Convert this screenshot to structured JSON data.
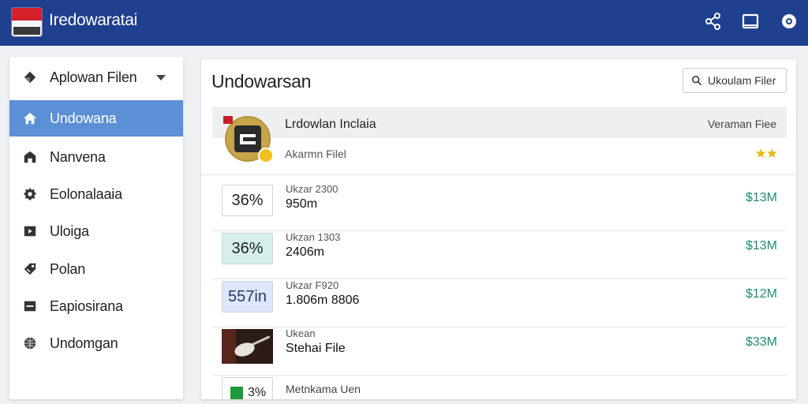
{
  "header": {
    "title": "Iredowaratai",
    "icons": [
      "share-icon",
      "window-icon",
      "settings-icon"
    ]
  },
  "sidebar": {
    "items": [
      {
        "label": "Aplowan Filen",
        "icon": "diamond-icon",
        "dropdown": true
      },
      {
        "label": "Undowana",
        "icon": "home-icon",
        "active": true
      },
      {
        "label": "Nanvena",
        "icon": "building-icon"
      },
      {
        "label": "Eolonalaaia",
        "icon": "gear-icon"
      },
      {
        "label": "Uloiga",
        "icon": "play-icon"
      },
      {
        "label": "Polan",
        "icon": "tag-icon"
      },
      {
        "label": "Eapiosirana",
        "icon": "minus-icon"
      },
      {
        "label": "Undomgan",
        "icon": "globe-icon"
      }
    ]
  },
  "main": {
    "title": "Undowarsan",
    "search_button": "Ukoulam Filer",
    "featured": {
      "title": "Lrdowlan Inclaia",
      "right_label": "Veraman Fiee",
      "subtitle": "Akarmn Filel",
      "stars": "★★"
    },
    "rows": [
      {
        "badge": "36%",
        "line1": "Ukzar 2300",
        "line2": "950m",
        "price": "$13M",
        "badge_bg": "#ffffff"
      },
      {
        "badge": "36%",
        "line1": "Ukzan 1303",
        "line2": "2406m",
        "price": "$13M",
        "badge_bg": "#d6efea"
      },
      {
        "badge": "557in",
        "line1": "Ukzar F920",
        "line2": "1.806m 8806",
        "price": "$12M",
        "badge_bg": "#dde6fb"
      },
      {
        "badge": "",
        "line1": "Ukean",
        "line2": "Stehai File",
        "price": "$33M",
        "badge_bg": "#2c1b17",
        "image": "guitar-thumbnail"
      },
      {
        "badge": "3%",
        "line1": "",
        "line2": "Metnkama Uen",
        "price": "",
        "badge_bg": "#ffffff"
      }
    ]
  },
  "colors": {
    "header_bg": "#1f3f8f",
    "active_bg": "#5b8fd6",
    "price": "#1f8c74",
    "star": "#e2b90f"
  }
}
